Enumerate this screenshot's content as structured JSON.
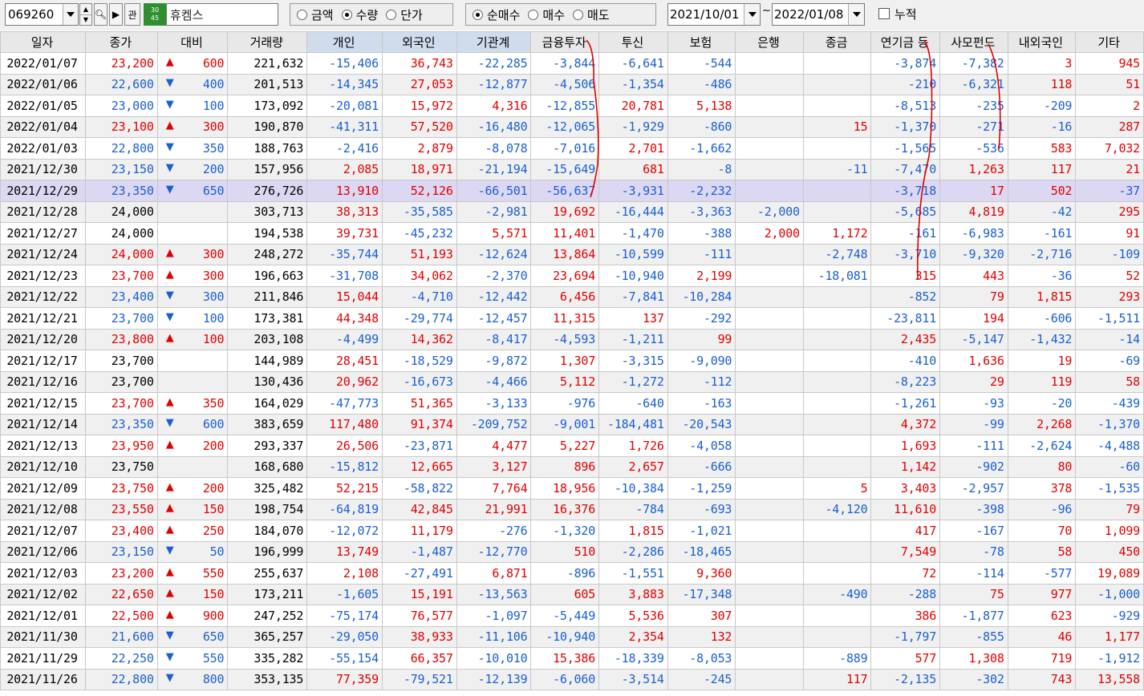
{
  "toolbar": {
    "stock_code": "069260",
    "badge_top": "30",
    "badge_bottom": "45",
    "related_label": "관",
    "stock_name": "휴켐스",
    "unit_options": [
      {
        "label": "금액",
        "selected": false
      },
      {
        "label": "수량",
        "selected": true
      },
      {
        "label": "단가",
        "selected": false
      }
    ],
    "mode_options": [
      {
        "label": "순매수",
        "selected": true
      },
      {
        "label": "매수",
        "selected": false
      },
      {
        "label": "매도",
        "selected": false
      }
    ],
    "date_from": "2021/10/01",
    "date_sep": "~",
    "date_to": "2022/01/08",
    "cumulative_label": "누적"
  },
  "colors": {
    "up": "#e00000",
    "down": "#1a5fd0",
    "selected_row": "#dcd7f2",
    "annotation": "#e00000"
  },
  "table": {
    "columns": [
      "일자",
      "종가",
      "대비",
      "거래량",
      "개인",
      "외국인",
      "기관계",
      "금융투자",
      "투신",
      "보험",
      "은행",
      "종금",
      "연기금 등",
      "사모펀드",
      "내외국인",
      "기타"
    ],
    "selected_date": "2021/12/29",
    "rows": [
      [
        "2022/01/07",
        "23,200",
        "▲",
        "600",
        "221,632",
        "-15,406",
        "36,743",
        "-22,285",
        "-3,844",
        "-6,641",
        "-544",
        "",
        "",
        "-3,874",
        "-7,382",
        "3",
        "945"
      ],
      [
        "2022/01/06",
        "22,600",
        "▼",
        "400",
        "201,513",
        "-14,345",
        "27,053",
        "-12,877",
        "-4,506",
        "-1,354",
        "-486",
        "",
        "",
        "-210",
        "-6,321",
        "118",
        "51"
      ],
      [
        "2022/01/05",
        "23,000",
        "▼",
        "100",
        "173,092",
        "-20,081",
        "15,972",
        "4,316",
        "-12,855",
        "20,781",
        "5,138",
        "",
        "",
        "-8,513",
        "-235",
        "-209",
        "2"
      ],
      [
        "2022/01/04",
        "23,100",
        "▲",
        "300",
        "190,870",
        "-41,311",
        "57,520",
        "-16,480",
        "-12,065",
        "-1,929",
        "-860",
        "",
        "15",
        "-1,370",
        "-271",
        "-16",
        "287"
      ],
      [
        "2022/01/03",
        "22,800",
        "▼",
        "350",
        "188,763",
        "-2,416",
        "2,879",
        "-8,078",
        "-7,016",
        "2,701",
        "-1,662",
        "",
        "",
        "-1,565",
        "-536",
        "583",
        "7,032"
      ],
      [
        "2021/12/30",
        "23,150",
        "▼",
        "200",
        "157,956",
        "2,085",
        "18,971",
        "-21,194",
        "-15,649",
        "681",
        "-8",
        "",
        "-11",
        "-7,470",
        "1,263",
        "117",
        "21"
      ],
      [
        "2021/12/29",
        "23,350",
        "▼",
        "650",
        "276,726",
        "13,910",
        "52,126",
        "-66,501",
        "-56,637",
        "-3,931",
        "-2,232",
        "",
        "",
        "-3,718",
        "17",
        "502",
        "-37"
      ],
      [
        "2021/12/28",
        "24,000",
        "",
        "",
        "303,713",
        "38,313",
        "-35,585",
        "-2,981",
        "19,692",
        "-16,444",
        "-3,363",
        "-2,000",
        "",
        "-5,685",
        "4,819",
        "-42",
        "295"
      ],
      [
        "2021/12/27",
        "24,000",
        "",
        "",
        "194,538",
        "39,731",
        "-45,232",
        "5,571",
        "11,401",
        "-1,470",
        "-388",
        "2,000",
        "1,172",
        "-161",
        "-6,983",
        "-161",
        "91"
      ],
      [
        "2021/12/24",
        "24,000",
        "▲",
        "300",
        "248,272",
        "-35,744",
        "51,193",
        "-12,624",
        "13,864",
        "-10,599",
        "-111",
        "",
        "-2,748",
        "-3,710",
        "-9,320",
        "-2,716",
        "-109"
      ],
      [
        "2021/12/23",
        "23,700",
        "▲",
        "300",
        "196,663",
        "-31,708",
        "34,062",
        "-2,370",
        "23,694",
        "-10,940",
        "2,199",
        "",
        "-18,081",
        "315",
        "443",
        "-36",
        "52"
      ],
      [
        "2021/12/22",
        "23,400",
        "▼",
        "300",
        "211,846",
        "15,044",
        "-4,710",
        "-12,442",
        "6,456",
        "-7,841",
        "-10,284",
        "",
        "",
        "-852",
        "79",
        "1,815",
        "293"
      ],
      [
        "2021/12/21",
        "23,700",
        "▼",
        "100",
        "173,381",
        "44,348",
        "-29,774",
        "-12,457",
        "11,315",
        "137",
        "-292",
        "",
        "",
        "-23,811",
        "194",
        "-606",
        "-1,511"
      ],
      [
        "2021/12/20",
        "23,800",
        "▲",
        "100",
        "203,108",
        "-4,499",
        "14,362",
        "-8,417",
        "-4,593",
        "-1,211",
        "99",
        "",
        "",
        "2,435",
        "-5,147",
        "-1,432",
        "-14"
      ],
      [
        "2021/12/17",
        "23,700",
        "",
        "",
        "144,989",
        "28,451",
        "-18,529",
        "-9,872",
        "1,307",
        "-3,315",
        "-9,090",
        "",
        "",
        "-410",
        "1,636",
        "19",
        "-69"
      ],
      [
        "2021/12/16",
        "23,700",
        "",
        "",
        "130,436",
        "20,962",
        "-16,673",
        "-4,466",
        "5,112",
        "-1,272",
        "-112",
        "",
        "",
        "-8,223",
        "29",
        "119",
        "58"
      ],
      [
        "2021/12/15",
        "23,700",
        "▲",
        "350",
        "164,029",
        "-47,773",
        "51,365",
        "-3,133",
        "-976",
        "-640",
        "-163",
        "",
        "",
        "-1,261",
        "-93",
        "-20",
        "-439"
      ],
      [
        "2021/12/14",
        "23,350",
        "▼",
        "600",
        "383,659",
        "117,480",
        "91,374",
        "-209,752",
        "-9,001",
        "-184,481",
        "-20,543",
        "",
        "",
        "4,372",
        "-99",
        "2,268",
        "-1,370"
      ],
      [
        "2021/12/13",
        "23,950",
        "▲",
        "200",
        "293,337",
        "26,506",
        "-23,871",
        "4,477",
        "5,227",
        "1,726",
        "-4,058",
        "",
        "",
        "1,693",
        "-111",
        "-2,624",
        "-4,488"
      ],
      [
        "2021/12/10",
        "23,750",
        "",
        "",
        "168,680",
        "-15,812",
        "12,665",
        "3,127",
        "896",
        "2,657",
        "-666",
        "",
        "",
        "1,142",
        "-902",
        "80",
        "-60"
      ],
      [
        "2021/12/09",
        "23,750",
        "▲",
        "200",
        "325,482",
        "52,215",
        "-58,822",
        "7,764",
        "18,956",
        "-10,384",
        "-1,259",
        "",
        "5",
        "3,403",
        "-2,957",
        "378",
        "-1,535"
      ],
      [
        "2021/12/08",
        "23,550",
        "▲",
        "150",
        "198,754",
        "-64,819",
        "42,845",
        "21,991",
        "16,376",
        "-784",
        "-693",
        "",
        "-4,120",
        "11,610",
        "-398",
        "-96",
        "79"
      ],
      [
        "2021/12/07",
        "23,400",
        "▲",
        "250",
        "184,070",
        "-12,072",
        "11,179",
        "-276",
        "-1,320",
        "1,815",
        "-1,021",
        "",
        "",
        "417",
        "-167",
        "70",
        "1,099"
      ],
      [
        "2021/12/06",
        "23,150",
        "▼",
        "50",
        "196,999",
        "13,749",
        "-1,487",
        "-12,770",
        "510",
        "-2,286",
        "-18,465",
        "",
        "",
        "7,549",
        "-78",
        "58",
        "450"
      ],
      [
        "2021/12/03",
        "23,200",
        "▲",
        "550",
        "255,637",
        "2,108",
        "-27,491",
        "6,871",
        "-896",
        "-1,551",
        "9,360",
        "",
        "",
        "72",
        "-114",
        "-577",
        "19,089"
      ],
      [
        "2021/12/02",
        "22,650",
        "▲",
        "150",
        "173,211",
        "-1,605",
        "15,191",
        "-13,563",
        "605",
        "3,883",
        "-17,348",
        "",
        "-490",
        "-288",
        "75",
        "977",
        "-1,000"
      ],
      [
        "2021/12/01",
        "22,500",
        "▲",
        "900",
        "247,252",
        "-75,174",
        "76,577",
        "-1,097",
        "-5,449",
        "5,536",
        "307",
        "",
        "",
        "386",
        "-1,877",
        "623",
        "-929"
      ],
      [
        "2021/11/30",
        "21,600",
        "▼",
        "650",
        "365,257",
        "-29,050",
        "38,933",
        "-11,106",
        "-10,940",
        "2,354",
        "132",
        "",
        "",
        "-1,797",
        "-855",
        "46",
        "1,177"
      ],
      [
        "2021/11/29",
        "22,250",
        "▼",
        "550",
        "335,282",
        "-55,154",
        "66,357",
        "-10,010",
        "15,386",
        "-18,339",
        "-8,053",
        "",
        "-889",
        "577",
        "1,308",
        "719",
        "-1,912"
      ],
      [
        "2021/11/26",
        "22,800",
        "▼",
        "800",
        "353,135",
        "77,359",
        "-79,521",
        "-12,139",
        "-6,060",
        "-3,514",
        "-245",
        "",
        "117",
        "-2,135",
        "-302",
        "743",
        "13,558"
      ]
    ]
  }
}
